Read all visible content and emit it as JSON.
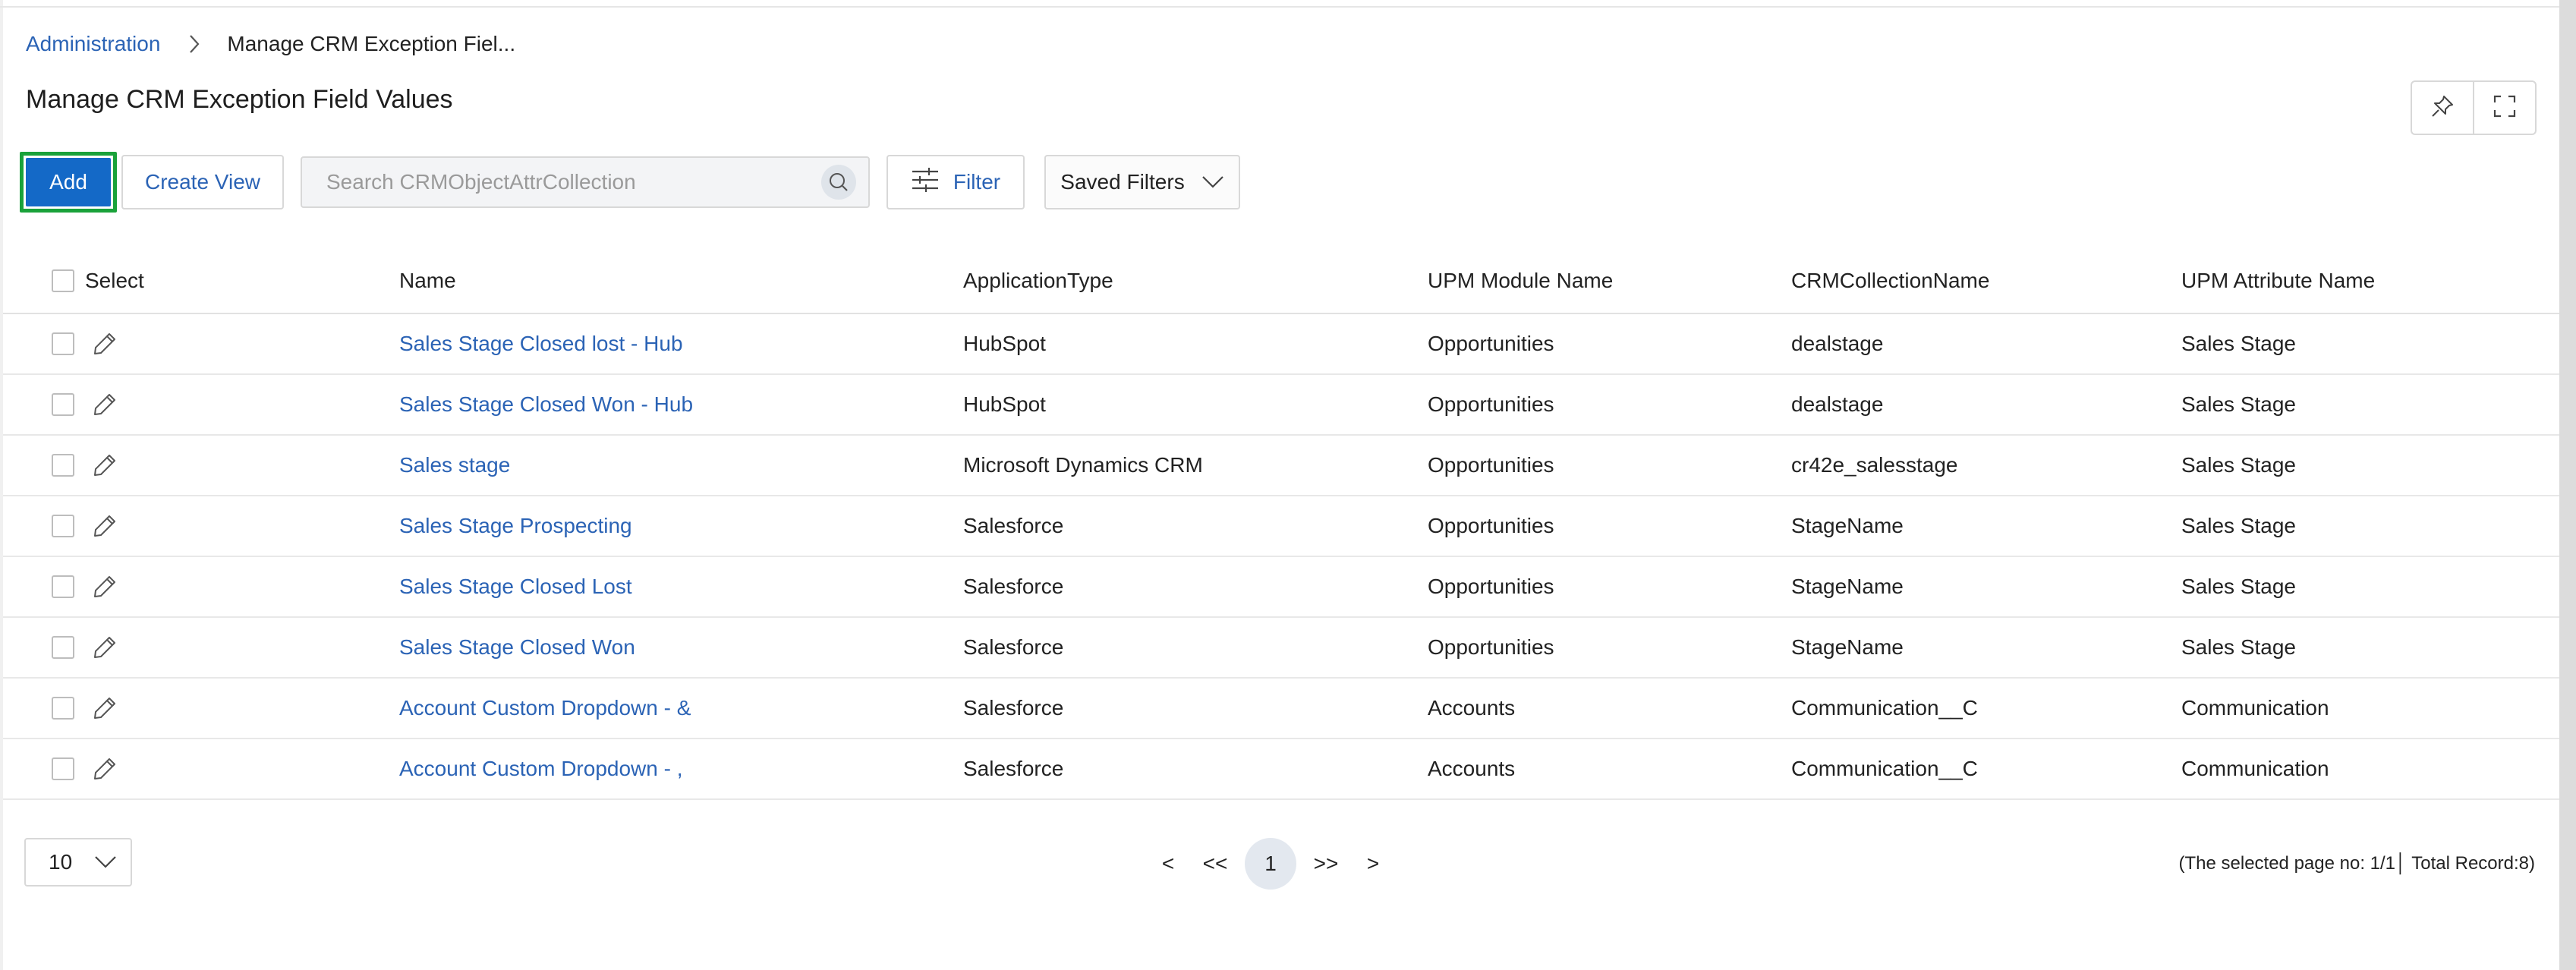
{
  "breadcrumb": {
    "parent": "Administration",
    "current": "Manage CRM Exception Fiel..."
  },
  "page": {
    "title": "Manage CRM Exception Field Values"
  },
  "toolbar": {
    "add_label": "Add",
    "create_view_label": "Create View",
    "search_placeholder": "Search CRMObjectAttrCollection",
    "filter_label": "Filter",
    "saved_filters_label": "Saved Filters"
  },
  "table": {
    "columns": {
      "select": "Select",
      "name": "Name",
      "application_type": "ApplicationType",
      "upm_module_name": "UPM Module Name",
      "crm_collection_name": "CRMCollectionName",
      "upm_attribute_name": "UPM Attribute Name"
    },
    "rows": [
      {
        "name": "Sales Stage Closed lost - Hub",
        "application_type": "HubSpot",
        "module": "Opportunities",
        "collection": "dealstage",
        "attribute": "Sales Stage"
      },
      {
        "name": "Sales Stage Closed Won - Hub",
        "application_type": "HubSpot",
        "module": "Opportunities",
        "collection": "dealstage",
        "attribute": "Sales Stage"
      },
      {
        "name": "Sales stage",
        "application_type": "Microsoft Dynamics CRM",
        "module": "Opportunities",
        "collection": "cr42e_salesstage",
        "attribute": "Sales Stage"
      },
      {
        "name": "Sales Stage Prospecting",
        "application_type": "Salesforce",
        "module": "Opportunities",
        "collection": "StageName",
        "attribute": "Sales Stage"
      },
      {
        "name": "Sales Stage Closed Lost",
        "application_type": "Salesforce",
        "module": "Opportunities",
        "collection": "StageName",
        "attribute": "Sales Stage"
      },
      {
        "name": "Sales Stage Closed Won",
        "application_type": "Salesforce",
        "module": "Opportunities",
        "collection": "StageName",
        "attribute": "Sales Stage"
      },
      {
        "name": "Account Custom Dropdown - &",
        "application_type": "Salesforce",
        "module": "Accounts",
        "collection": "Communication__C",
        "attribute": "Communication"
      },
      {
        "name": "Account Custom Dropdown - ,",
        "application_type": "Salesforce",
        "module": "Accounts",
        "collection": "Communication__C",
        "attribute": "Communication"
      }
    ]
  },
  "pagination": {
    "page_size": "10",
    "prev": "<",
    "first": "<<",
    "current_page": "1",
    "last": ">>",
    "next": ">",
    "info": "(The selected page no: 1/1│ Total Record:8)"
  },
  "colors": {
    "accent": "#1469c7",
    "link": "#2b63b5",
    "highlight_border": "#1aa23a"
  },
  "icons": {
    "breadcrumb_separator": "chevron-right-icon",
    "pin": "pin-icon",
    "fullscreen": "expand-icon",
    "search": "search-icon",
    "filter": "sliders-icon",
    "saved_filters": "chevron-down-icon",
    "row_edit": "pencil-icon",
    "page_size": "chevron-down-icon"
  }
}
